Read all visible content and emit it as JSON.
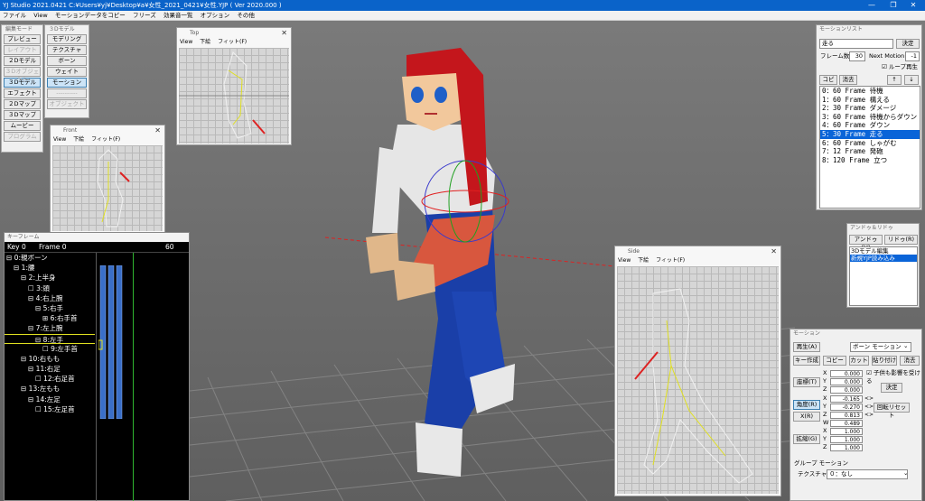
{
  "titlebar": {
    "title": "YJ Studio 2021.0421   C:¥Users¥yj¥Desktop¥a¥女性_2021_0421¥女性.YJP ( Ver 2020.000 )",
    "minimize": "—",
    "maximize": "❐",
    "close": "✕"
  },
  "menu": [
    "ファイル",
    "View",
    "モーションデータをコピー",
    "フリーズ",
    "効果音一覧",
    "オプション",
    "その他"
  ],
  "edit_mode": {
    "title": "編集モード",
    "buttons": [
      "プレビュー",
      "レイアウト",
      "２Dモデル",
      "３Dオブジェクト",
      "３Dモデル",
      "エフェクト",
      "２Dマップ",
      "３Dマップ",
      "ムービー",
      "プログラム"
    ]
  },
  "model_panel": {
    "title": "３Dモデル",
    "buttons": [
      "モデリング",
      "テクスチャ",
      "ボーン",
      "ウェイト",
      "モーション",
      "----------",
      "オブジェクト"
    ]
  },
  "top_view": {
    "title": "Top",
    "menu": [
      "View",
      "下絵",
      "フィット(F)"
    ],
    "close": "✕"
  },
  "front_view": {
    "title": "Front",
    "menu": [
      "View",
      "下絵",
      "フィット(F)"
    ],
    "close": "✕"
  },
  "side_view": {
    "title": "Side",
    "menu": [
      "View",
      "下絵",
      "フィット(F)"
    ],
    "close": "✕"
  },
  "keyframe": {
    "title": "キーフレーム",
    "key_label": "Key 0",
    "frame_label": "Frame 0",
    "frame_end": "60",
    "bones": [
      "⊟ 0:親ボーン",
      "⊟ 1:腰",
      "⊟ 2:上半身",
      "☐ 3:頭",
      "⊟ 4:右上腕",
      "⊟ 5:右手",
      "⊞ 6:右手首",
      "⊟ 7:左上腕",
      "⊟ 8:左手",
      "☐ 9:左手首",
      "⊟ 10:右もも",
      "⊟ 11:右足",
      "☐ 12:右足首",
      "⊟ 13:左もも",
      "⊟ 14:左足",
      "☐ 15:左足首"
    ]
  },
  "motion_list": {
    "title": "モーションリスト",
    "name_value": "走る",
    "decide": "決定",
    "frame_count_label": "フレーム数",
    "frame_count": "30",
    "next_motion_label": "Next Motion",
    "next_motion": "-1",
    "loop_label": "ループ再生",
    "copy": "コピー",
    "delete": "消去",
    "up": "↑",
    "down": "↓",
    "items": [
      "0：60 Frame  待機",
      "1：60 Frame  構える",
      "2：30 Frame  ダメージ",
      "3：60 Frame  待機からダウン",
      "4：60 Frame  ダウン",
      "5：30 Frame  走る",
      "6：60 Frame  しゃがむ",
      "7：12 Frame  発砲",
      "8：120 Frame  立つ"
    ],
    "selected_index": 5
  },
  "undo_redo": {
    "title": "アンドゥ＆リドゥ",
    "undo": "アンドゥ(U)",
    "redo": "リドゥ(R)",
    "items": [
      "3Dモデル編集",
      "新規YJP読み込み"
    ]
  },
  "motion_panel": {
    "title": "モーション",
    "play": "再生(A)",
    "mode": "ボーン  モーション",
    "key_create": "キー作成",
    "copy": "コピー",
    "cut": "カット",
    "paste": "貼り付け",
    "delete": "消去",
    "child_label": "子供も影響を受ける",
    "decide": "決定",
    "position": "座標(T)",
    "angle": "角度(R)",
    "x_axis": "X(R)",
    "rotate_reset": "回転リセット",
    "scale": "拡縮(G)",
    "group_label": "グループ  モーション",
    "texture_label": "テクスチャ",
    "texture_value": "０：なし",
    "pos": {
      "X": "0.000",
      "Y": "0.000",
      "Z": "0.000"
    },
    "rot": {
      "X": "-0.165",
      "Y": "-0.270",
      "Z": "0.813",
      "W": "0.489"
    },
    "scl": {
      "X": "1.000",
      "Y": "1.000",
      "Z": "1.000"
    }
  },
  "colors": {
    "titlebar": "#0a63c9",
    "selection": "#0a64d8",
    "viewport": "#707070",
    "hair": "#c4161c",
    "pants": "#1a3fa8"
  }
}
